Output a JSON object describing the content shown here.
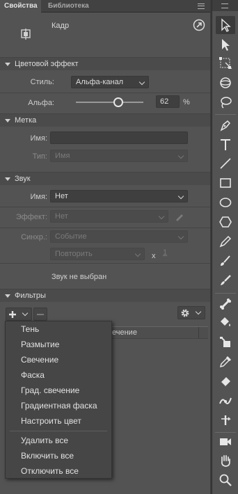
{
  "tabs": [
    {
      "label": "Свойства",
      "active": true
    },
    {
      "label": "Библиотека",
      "active": false
    }
  ],
  "header": {
    "label": "Кадр"
  },
  "color_effect": {
    "title": "Цветовой эффект",
    "style_label": "Стиль:",
    "style_value": "Альфа-канал",
    "alpha_label": "Альфа:",
    "alpha_value": "62",
    "alpha_unit": "%",
    "alpha_fraction": 0.62
  },
  "label_section": {
    "title": "Метка",
    "name_label": "Имя:",
    "name_value": "",
    "type_label": "Тип:",
    "type_value": "Имя"
  },
  "sound": {
    "title": "Звук",
    "name_label": "Имя:",
    "name_value": "Нет",
    "effect_label": "Эффект:",
    "effect_value": "Нет",
    "sync_label": "Синхр.:",
    "sync_value": "Событие",
    "repeat_value": "Повторить",
    "repeat_x": "x",
    "repeat_count": "1",
    "status": "Звук не выбран"
  },
  "filters": {
    "title": "Фильтры",
    "column_fragment": "ечение",
    "menu": {
      "filter_items": [
        "Тень",
        "Размытие",
        "Свечение",
        "Фаска",
        "Град. свечение",
        "Градиентная фаска",
        "Настроить цвет"
      ],
      "action_items": [
        "Удалить все",
        "Включить все",
        "Отключить все"
      ]
    }
  },
  "tools": [
    "selection-tool",
    "subselection-tool",
    "free-transform-tool",
    "3d-rotation-tool",
    "lasso-tool",
    "pen-tool",
    "text-tool",
    "line-tool",
    "rectangle-tool",
    "oval-tool",
    "polystar-tool",
    "pencil-tool",
    "paint-brush-tool",
    "brush-tool",
    "bone-tool",
    "paint-bucket-tool",
    "ink-bottle-tool",
    "eyedropper-tool",
    "eraser-tool",
    "width-tool",
    "asset-warp-tool",
    "camera-tool",
    "hand-tool",
    "zoom-tool"
  ]
}
